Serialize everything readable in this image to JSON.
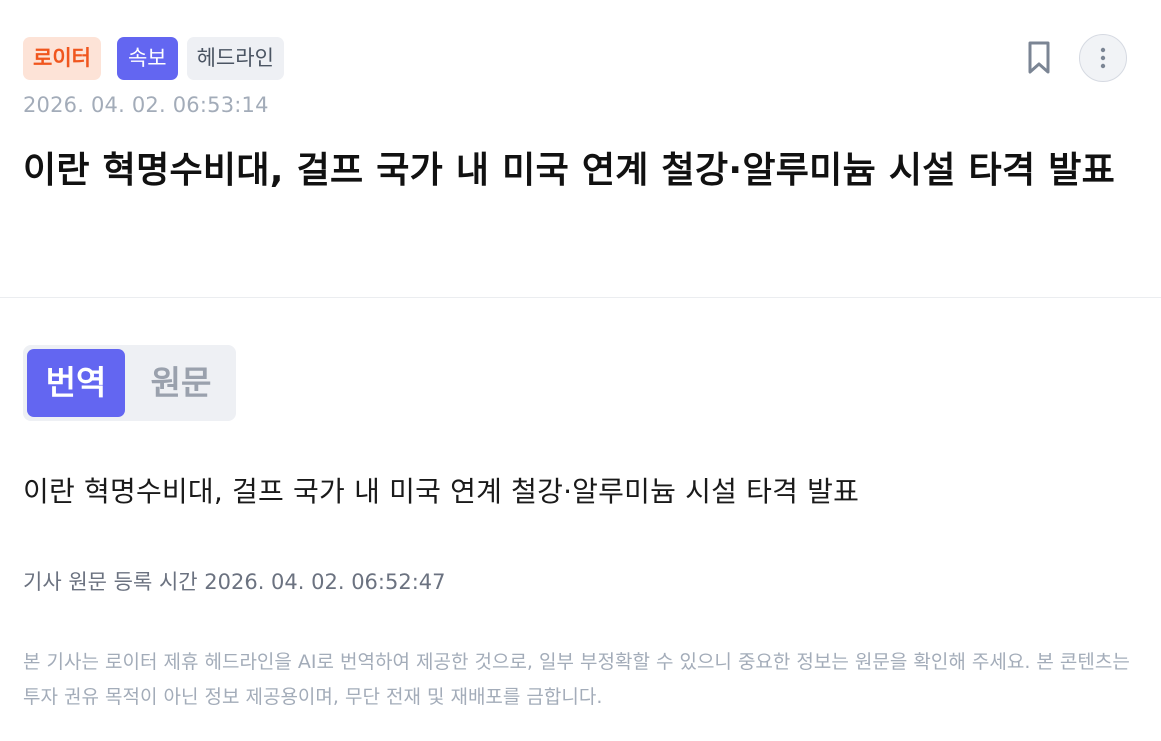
{
  "article": {
    "tags": {
      "source": "로이터",
      "breaking": "속보",
      "category": "헤드라인"
    },
    "timestamp": "2026. 04. 02. 06:53:14",
    "title": "이란 혁명수비대, 걸프 국가 내 미국 연계 철강·알루미늄 시설 타격 발표",
    "actions": {
      "bookmark_icon": "bookmark-icon",
      "more_icon": "more-vertical-icon"
    }
  },
  "view_toggle": {
    "options": [
      "번역",
      "원문"
    ],
    "selected": "번역"
  },
  "body": {
    "translated_text": "이란 혁명수비대, 걸프 국가 내 미국 연계 철강·알루미늄 시설 타격 발표",
    "original_registration": "기사 원문 등록 시간 2026. 04. 02. 06:52:47",
    "disclaimer": "본 기사는 로이터 제휴 헤드라인을 AI로 번역하여 제공한 것으로, 일부 부정확할 수 있으니 중요한 정보는 원문을 확인해 주세요. 본 콘텐츠는 투자 권유 목적이 아닌 정보 제공용이며, 무단 전재 및 재배포를 금합니다."
  },
  "colors": {
    "accent": "#6366f1",
    "source_tag_text": "#f0561e",
    "source_tag_bg": "#fde3d7",
    "muted_text": "#a3acb9"
  }
}
